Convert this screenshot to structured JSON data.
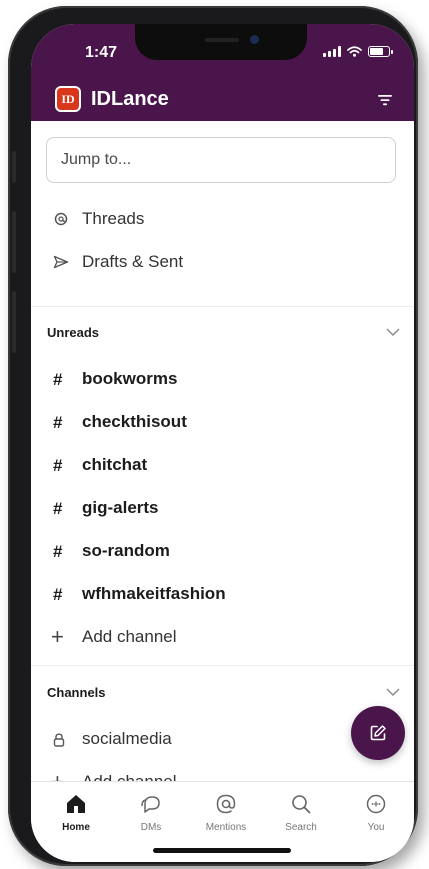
{
  "status": {
    "time": "1:47"
  },
  "workspace": {
    "logo_text": "ID",
    "name": "IDLance"
  },
  "search": {
    "placeholder": "Jump to..."
  },
  "nav": [
    {
      "label": "Threads",
      "icon": "threads-icon"
    },
    {
      "label": "Drafts & Sent",
      "icon": "send-icon"
    }
  ],
  "unreads": {
    "title": "Unreads",
    "channels": [
      "bookworms",
      "checkthisout",
      "chitchat",
      "gig-alerts",
      "so-random",
      "wfhmakeitfashion"
    ],
    "add_label": "Add channel"
  },
  "channels": {
    "title": "Channels",
    "items": [
      {
        "name": "socialmedia",
        "icon": "lock-icon"
      }
    ],
    "add_label": "Add channel"
  },
  "tabs": [
    {
      "label": "Home",
      "icon": "home-icon",
      "active": true
    },
    {
      "label": "DMs",
      "icon": "dms-icon",
      "active": false
    },
    {
      "label": "Mentions",
      "icon": "mention-icon",
      "active": false
    },
    {
      "label": "Search",
      "icon": "search-icon",
      "active": false
    },
    {
      "label": "You",
      "icon": "you-icon",
      "active": false
    }
  ],
  "colors": {
    "brand": "#4a154b",
    "logo": "#d9371b"
  }
}
